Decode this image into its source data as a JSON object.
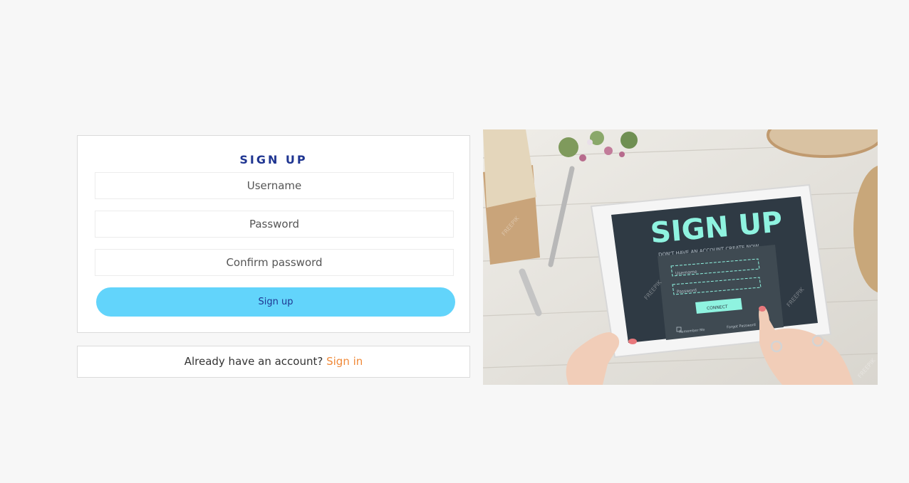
{
  "signup": {
    "title": "SIGN UP",
    "username_placeholder": "Username",
    "password_placeholder": "Password",
    "confirm_placeholder": "Confirm password",
    "button_label": "Sign up"
  },
  "signin": {
    "prompt": "Already have an account?",
    "link_label": "Sign in"
  },
  "hero": {
    "screen_title": "SIGN UP",
    "screen_subtitle": "DON'T HAVE AN ACCOUNT CREATE NOW",
    "username_label": "Username",
    "password_label": "Password",
    "connect_label": "CONNECT",
    "remember_label": "Remember Me",
    "forgot_label": "Forgot Password",
    "watermark": "FREEPIK"
  },
  "colors": {
    "title": "#1f3591",
    "button": "#62d4fb",
    "link": "#f08a3a",
    "background": "#f7f7f7"
  }
}
